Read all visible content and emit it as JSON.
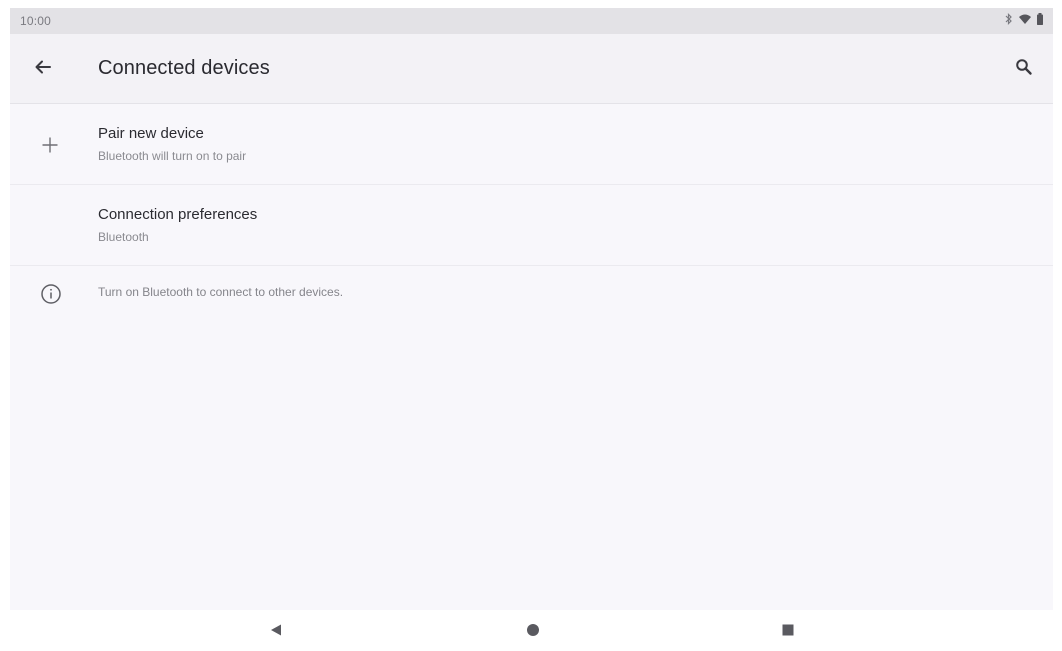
{
  "status_bar": {
    "time": "10:00",
    "icons": [
      "bluetooth-icon",
      "wifi-icon",
      "battery-icon"
    ]
  },
  "app_bar": {
    "title": "Connected devices",
    "back_icon": "arrow-back-icon",
    "search_icon": "search-icon"
  },
  "list": {
    "items": [
      {
        "icon": "plus-icon",
        "title": "Pair new device",
        "subtitle": "Bluetooth will turn on to pair"
      },
      {
        "icon": "",
        "title": "Connection preferences",
        "subtitle": "Bluetooth"
      }
    ],
    "info": {
      "icon": "info-icon",
      "text": "Turn on Bluetooth to connect to other devices."
    }
  },
  "nav_bar": {
    "buttons": [
      "nav-back-icon",
      "nav-home-icon",
      "nav-recents-icon"
    ]
  },
  "colors": {
    "screen_bg": "#f8f7fb",
    "app_bar_bg": "#f3f2f6",
    "status_bar_bg": "#e3e2e6",
    "title_text": "#2a2a30",
    "secondary_text": "#8a8a90"
  }
}
